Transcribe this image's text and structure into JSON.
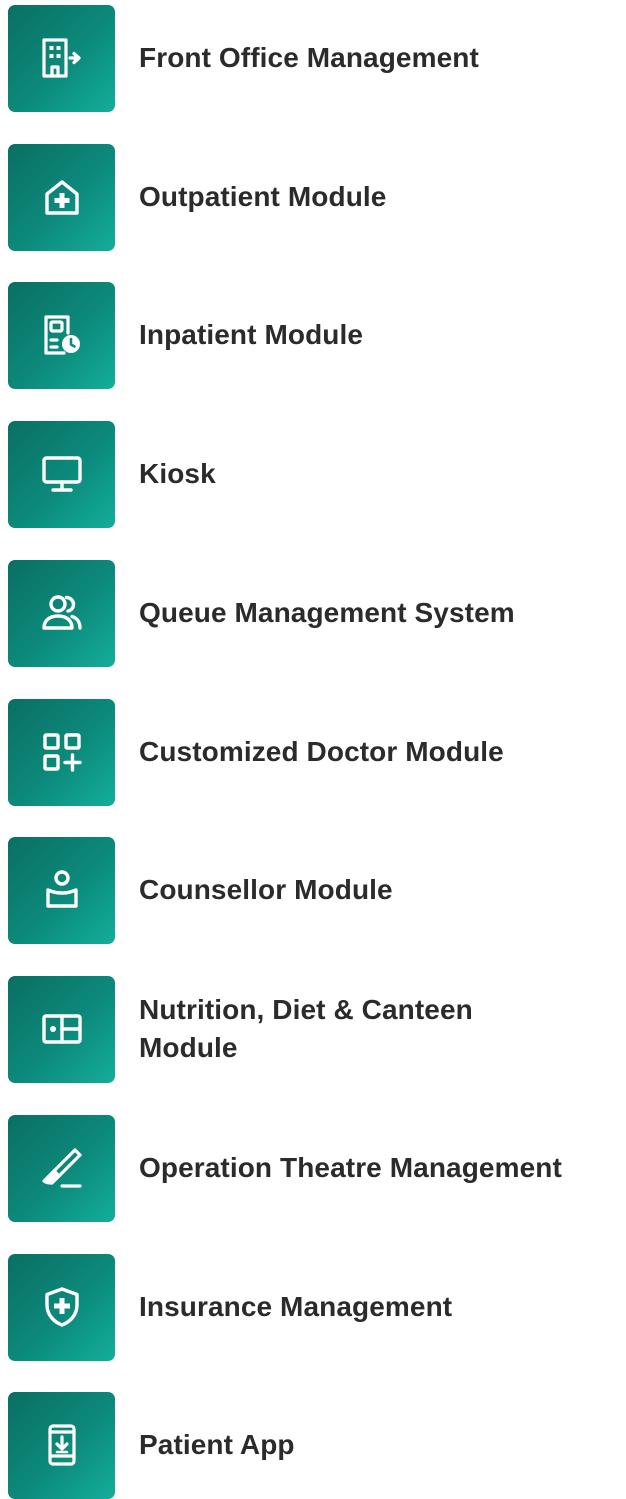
{
  "theme": {
    "tile_color": "#0c8a7b",
    "text_color": "#2b2b2b",
    "background": "#ffffff"
  },
  "modules": [
    {
      "label": "Front Office Management",
      "icon": "building-arrow-icon"
    },
    {
      "label": "Outpatient Module",
      "icon": "hospital-plus-icon"
    },
    {
      "label": "Inpatient Module",
      "icon": "patient-clock-icon"
    },
    {
      "label": "Kiosk",
      "icon": "monitor-icon"
    },
    {
      "label": "Queue Management System",
      "icon": "users-icon"
    },
    {
      "label": "Customized Doctor Module",
      "icon": "grid-plus-icon"
    },
    {
      "label": "Counsellor Module",
      "icon": "counsellor-icon"
    },
    {
      "label": "Nutrition, Diet & Canteen Module",
      "icon": "menu-card-icon"
    },
    {
      "label": "Operation Theatre Management",
      "icon": "scalpel-icon"
    },
    {
      "label": "Insurance Management",
      "icon": "shield-plus-icon"
    },
    {
      "label": "Patient App",
      "icon": "phone-download-icon"
    }
  ]
}
